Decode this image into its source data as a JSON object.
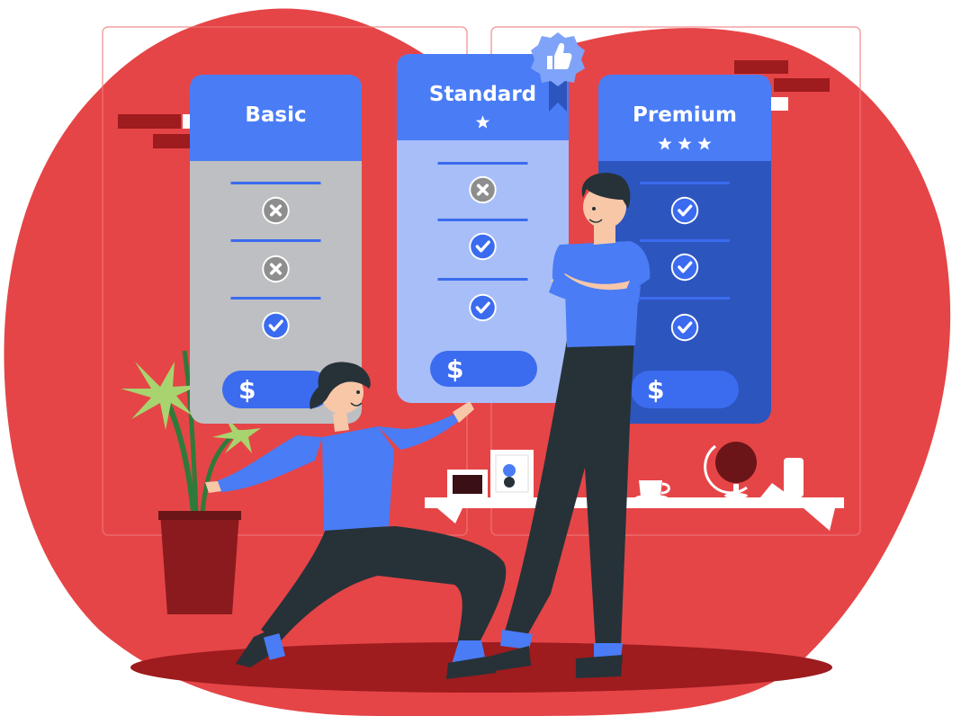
{
  "plans": [
    {
      "name": "Basic",
      "stars": 0,
      "features": [
        "cross",
        "cross",
        "check"
      ],
      "price_symbol": "$"
    },
    {
      "name": "Standard",
      "stars": 1,
      "features": [
        "cross",
        "check",
        "check"
      ],
      "price_symbol": "$"
    },
    {
      "name": "Premium",
      "stars": 3,
      "features": [
        "check",
        "check",
        "check"
      ],
      "price_symbol": "$"
    }
  ],
  "badge": {
    "icon": "thumbs-up-icon"
  },
  "colors": {
    "background_blob": "#E54547",
    "floor_shadow": "#9E1B1E",
    "basic_header": "#4A7CF6",
    "basic_body": "#BDBFC2",
    "standard_header": "#4A7CF6",
    "standard_body": "#A8BEF8",
    "premium_header": "#4A7CF6",
    "premium_body": "#2D55BE",
    "check": "#3B6BEF",
    "cross": "#8E8E8E",
    "shirt": "#4A7CF6",
    "pants": "#263238"
  }
}
